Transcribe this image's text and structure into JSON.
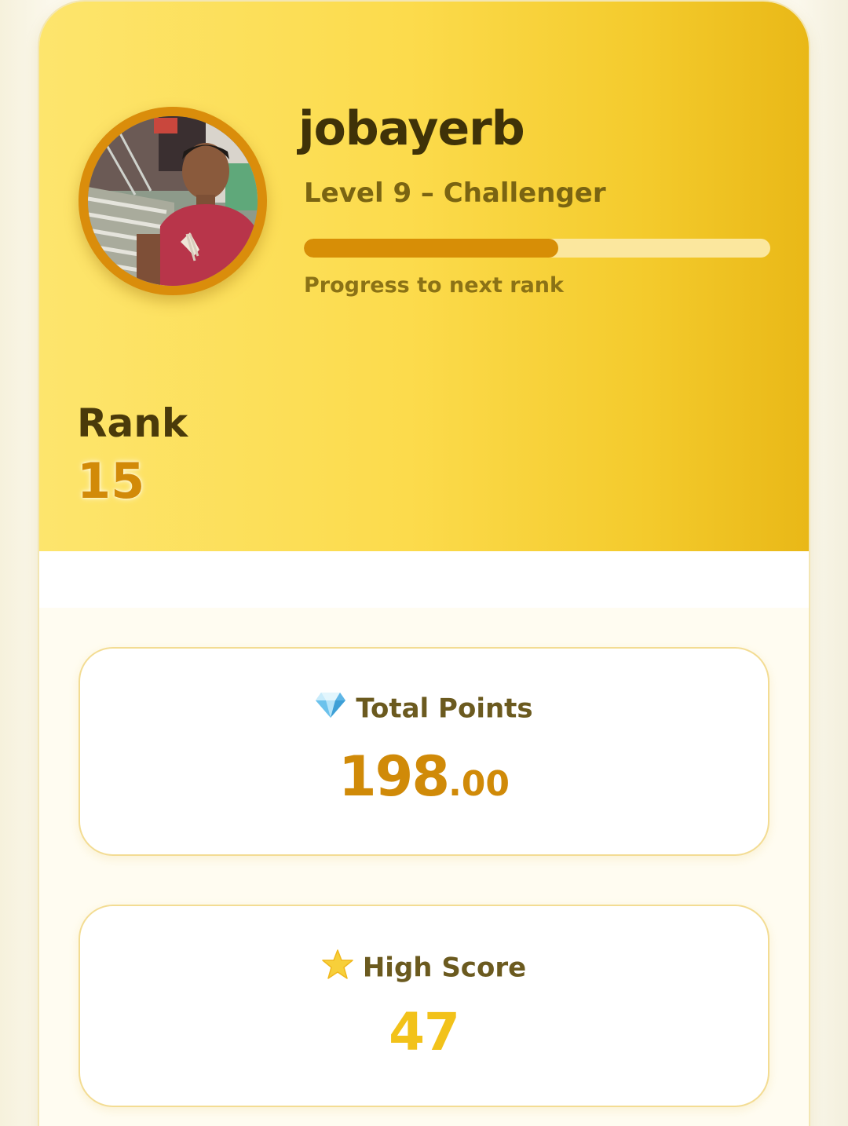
{
  "profile": {
    "username": "jobayerb",
    "level_text": "Level 9 – Challenger",
    "progress_fraction": 0.545,
    "progress_label": "Progress to next rank",
    "rank_label": "Rank",
    "rank_value": "15"
  },
  "stats": {
    "total_points": {
      "label": "Total Points",
      "icon": "diamond-icon",
      "value_int": "198",
      "value_dec": ".00"
    },
    "high_score": {
      "label": "High Score",
      "icon": "star-icon",
      "value": "47"
    }
  },
  "colors": {
    "accent": "#d78e06",
    "hero_start": "#fde56d",
    "hero_end": "#e9b817",
    "high_score": "#f2c21a"
  }
}
